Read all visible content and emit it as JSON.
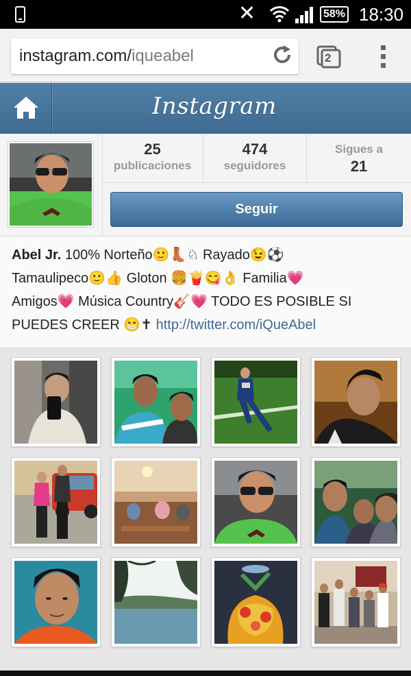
{
  "status_bar": {
    "battery": "58%",
    "time": "18:30"
  },
  "browser": {
    "url_host": "instagram.com/",
    "url_path": "iqueabel",
    "tab_count": "2"
  },
  "header": {
    "logo": "Instagram"
  },
  "profile": {
    "posts_count": "25",
    "posts_label": "publicaciones",
    "followers_count": "474",
    "followers_label": "seguidores",
    "following_label": "Sigues a",
    "following_count": "21",
    "follow_button": "Seguir"
  },
  "bio": {
    "name": "Abel Jr.",
    "line1": " 100% Norteño🙂👢♘ Rayado😉⚽",
    "line2": "Tamaulipeco🙂👍 Gloton 🍔🍟😋👌 Familia💗",
    "line3": "Amigos💗 Música Country🎸💗 TODO ES POSIBLE SI",
    "line4": "PUEDES CREER 😁✝ ",
    "link": "http://twitter.com/iQueAbel"
  },
  "photos": [
    {
      "alt": "selfie-mirror"
    },
    {
      "alt": "two-people-smiling"
    },
    {
      "alt": "soccer-player"
    },
    {
      "alt": "portrait-dark"
    },
    {
      "alt": "couple-by-car"
    },
    {
      "alt": "restaurant-interior"
    },
    {
      "alt": "selfie-car-sunglasses"
    },
    {
      "alt": "group-selfie"
    },
    {
      "alt": "close-up-selfie"
    },
    {
      "alt": "lake-landscape"
    },
    {
      "alt": "fruit-drink"
    },
    {
      "alt": "family-group"
    }
  ],
  "colors": {
    "header_blue": "#517fa4",
    "link_blue": "#3e6a94"
  }
}
